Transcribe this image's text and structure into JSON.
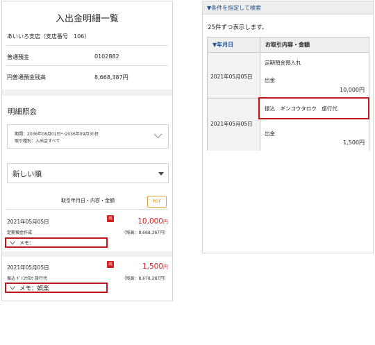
{
  "left": {
    "title": "入出金明細一覧",
    "branch": "あいいろ支店（支店番号　106）",
    "account_type_label": "普通預金",
    "account_number": "0102882",
    "balance_label": "円普通預金残高",
    "balance_value": "8,668,387円",
    "section_title": "明細照会",
    "period_line": "期間：2036年08月01日～2036年09月30日",
    "kind_line": "取引種別：入出金すべて",
    "sort_value": "新しい順",
    "column_header": "取引年月日・内容・金額",
    "pdf_label": "PDF",
    "transactions": [
      {
        "date": "2021年05月05日",
        "badge": "出",
        "amount": "10,000",
        "yen": "円",
        "description": "定期預金作成",
        "balance": "（残高：8,668,387円）",
        "memo": "メモ："
      },
      {
        "date": "2021年05月05日",
        "badge": "出",
        "amount": "1,500",
        "yen": "円",
        "description": "振込 ｷﾞﾝｺｳﾀﾛｳ 旅行代",
        "balance": "（残高：8,678,387円）",
        "memo": "メモ：娯楽"
      }
    ]
  },
  "right": {
    "header": "▼条件を指定して検索",
    "count_text": "25件ずつ表示します。",
    "col_date": "▼年月日",
    "col_content": "お取引内容・金額",
    "rows": [
      {
        "date": "2021年05月05日",
        "line1": "定期預金預入れ",
        "line2": "出金",
        "amount": "10,000円"
      },
      {
        "date": "2021年05月05日",
        "line1": "振込　ギンコウタロウ　旅行代",
        "line2": "出金",
        "amount": "1,500円"
      }
    ]
  },
  "colors": {
    "accent_blue": "#1d4f8f",
    "debit_red": "#d32020",
    "highlight_red": "#c0181f",
    "pdf_orange": "#e08a1e"
  }
}
